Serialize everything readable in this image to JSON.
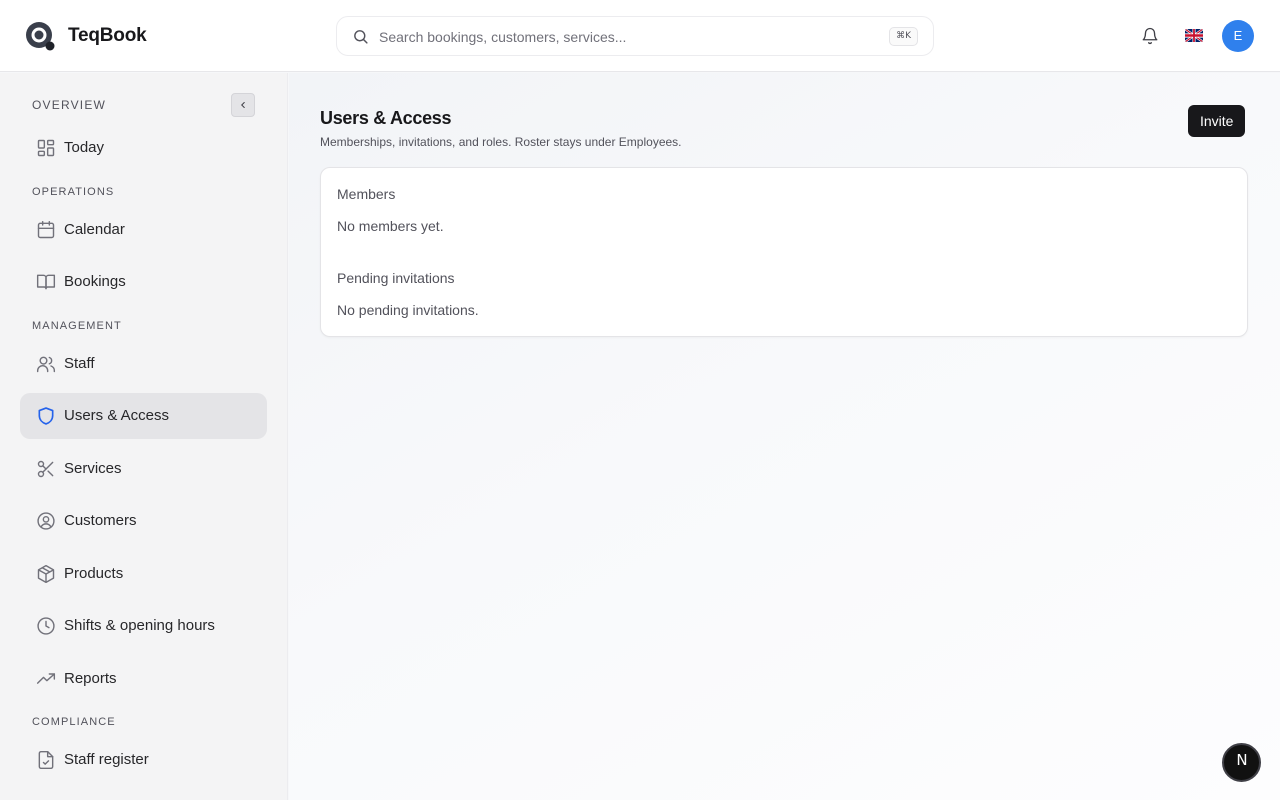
{
  "app": {
    "name": "TeqBook",
    "logo_icon": "teqbook-logo-icon"
  },
  "header": {
    "search_placeholder": "Search bookings, customers, services...",
    "search_value": "",
    "search_shortcut": "⌘K",
    "notification_icon": "bell-icon",
    "language_flag": "uk-flag-icon",
    "avatar_initial": "E",
    "avatar_color": "#2f80ed"
  },
  "sidebar": {
    "sections": [
      {
        "label": "Overview",
        "items": [
          {
            "label": "Today",
            "icon": "dashboard-grid-icon"
          }
        ]
      },
      {
        "label": "Operations",
        "items": [
          {
            "label": "Calendar",
            "icon": "calendar-icon"
          },
          {
            "label": "Bookings",
            "icon": "book-open-icon"
          }
        ]
      },
      {
        "label": "Management",
        "items": [
          {
            "label": "Staff",
            "icon": "users-icon"
          },
          {
            "label": "Users & Access",
            "icon": "shield-icon",
            "active": true
          },
          {
            "label": "Services",
            "icon": "scissors-icon"
          },
          {
            "label": "Customers",
            "icon": "user-circle-icon"
          },
          {
            "label": "Products",
            "icon": "package-icon"
          },
          {
            "label": "Shifts & opening hours",
            "icon": "clock-icon"
          },
          {
            "label": "Reports",
            "icon": "trending-up-icon"
          }
        ]
      },
      {
        "label": "Compliance",
        "items": [
          {
            "label": "Staff register",
            "icon": "file-check-icon"
          }
        ]
      }
    ],
    "active_color": "#2563eb"
  },
  "main": {
    "title": "Users & Access",
    "subtitle": "Memberships, invitations, and roles. Roster stays under Employees.",
    "invite_label": "Invite",
    "members": {
      "heading": "Members",
      "empty_text": "No members yet."
    },
    "invitations": {
      "heading": "Pending invitations",
      "empty_text": "No pending invitations."
    }
  },
  "dev_badge": {
    "letter": "N"
  }
}
